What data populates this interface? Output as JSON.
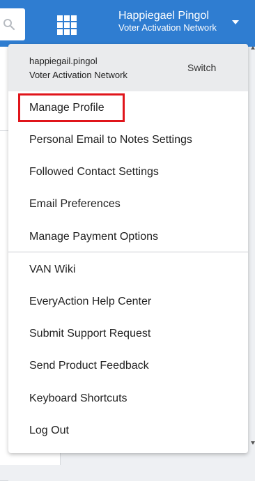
{
  "header": {
    "user_name": "Happiegael Pingol",
    "organization": "Voter Activation Network"
  },
  "dropdown": {
    "username": "happiegail.pingol",
    "organization": "Voter Activation Network",
    "switch_label": "Switch",
    "highlight_color": "#e0151b",
    "items": [
      {
        "label": "Manage Profile"
      },
      {
        "label": "Personal Email to Notes Settings"
      },
      {
        "label": "Followed Contact Settings"
      },
      {
        "label": "Email Preferences"
      },
      {
        "label": "Manage Payment Options"
      },
      {
        "label": "VAN Wiki"
      },
      {
        "label": "EveryAction Help Center"
      },
      {
        "label": "Submit Support Request"
      },
      {
        "label": "Send Product Feedback"
      },
      {
        "label": "Keyboard Shortcuts"
      },
      {
        "label": "Log Out"
      }
    ]
  },
  "icons": {
    "search": "search-icon",
    "apps": "app-grid-icon",
    "user_menu": "chevron-down-icon"
  },
  "colors": {
    "topbar": "#2f7dd1",
    "dropdown_header": "#eaebed"
  }
}
